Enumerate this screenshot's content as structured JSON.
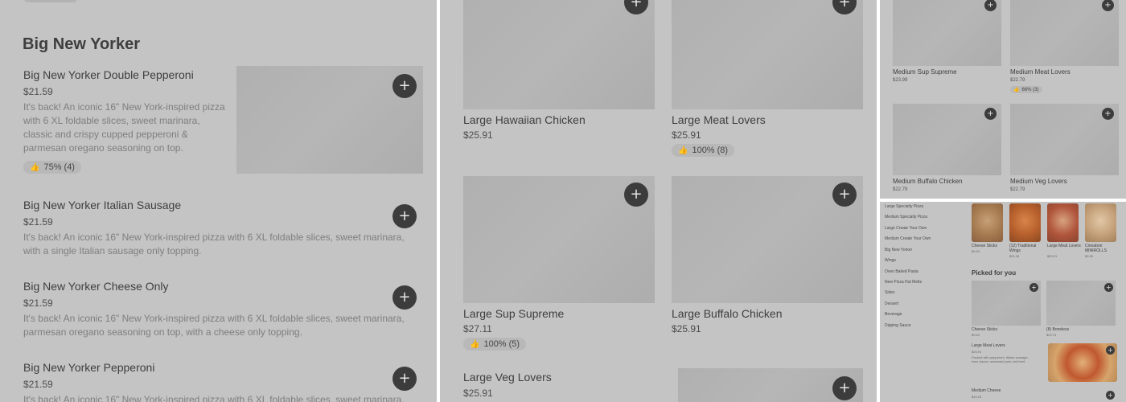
{
  "panel_a": {
    "section_title": "Big New Yorker",
    "items": [
      {
        "name": "Big New Yorker Double Pepperoni",
        "price": "$21.59",
        "description": "It's back! An iconic 16\" New York-inspired pizza with 6 XL foldable slices, sweet marinara, classic and crispy cupped pepperoni & parmesan oregano seasoning on top.",
        "rating": "75% (4)"
      },
      {
        "name": "Big New Yorker Italian Sausage",
        "price": "$21.59",
        "description": "It's back! An iconic 16\" New York-inspired pizza with 6 XL foldable slices, sweet marinara, with a single Italian sausage only topping."
      },
      {
        "name": "Big New Yorker Cheese Only",
        "price": "$21.59",
        "description": "It's back! An iconic 16\" New York-inspired pizza with 6 XL foldable slices, sweet marinara, parmesan oregano seasoning on top, with a cheese only topping."
      },
      {
        "name": "Big New Yorker Pepperoni",
        "price": "$21.59",
        "description": "It's back! An iconic 16\" New York-inspired pizza with 6 XL foldable slices, sweet marinara,"
      }
    ]
  },
  "panel_b": {
    "items": [
      {
        "name": "Large Hawaiian Chicken",
        "price": "$25.91"
      },
      {
        "name": "Large Meat Lovers",
        "price": "$25.91",
        "rating": "100% (8)"
      },
      {
        "name": "Large Sup Supreme",
        "price": "$27.11",
        "rating": "100% (5)"
      },
      {
        "name": "Large Buffalo Chicken",
        "price": "$25.91"
      },
      {
        "name": "Large Veg Lovers",
        "price": "$25.91"
      }
    ]
  },
  "panel_c": {
    "items": [
      {
        "name": "Medium Sup Supreme",
        "price": "$23.99"
      },
      {
        "name": "Medium Meat Lovers",
        "price": "$22.79",
        "rating": "66% (3)"
      },
      {
        "name": "Medium Buffalo Chicken",
        "price": "$22.79"
      },
      {
        "name": "Medium Veg Lovers",
        "price": "$22.79"
      }
    ]
  },
  "panel_d": {
    "categories": [
      "Large Specialty Pizza",
      "Medium Specialty Pizza",
      "Large Create Your Own",
      "Medium Create Your Own",
      "Big New Yorker",
      "Wings",
      "Oven Baked Pasta",
      "New Pizza Hut Melts",
      "Sides",
      "Dessert",
      "Beverage",
      "Dipping Sauce"
    ],
    "top_items": [
      {
        "name": "Cheese Sticks",
        "price": "$9.63"
      },
      {
        "name": "(12) Traditional Wings",
        "price": "$31.26"
      },
      {
        "name": "Large Meat Lovers",
        "price": "$25.91"
      },
      {
        "name": "Cinnabon MINIROLLS",
        "price": "$9.59"
      }
    ],
    "picked_title": "Picked for you",
    "picked": [
      {
        "name": "Cheese Sticks",
        "price": "$9.63"
      },
      {
        "name": "(8) Boneless",
        "price": "$20.79"
      }
    ],
    "list_item": {
      "name": "Large Meat Lovers",
      "price": "$25.91",
      "description": "Packed with pepperoni, Italian sausage, ham, bacon, seasoned pork and beef."
    },
    "bottom_item": {
      "name": "Medium Cheese",
      "price": "$15.23"
    }
  }
}
